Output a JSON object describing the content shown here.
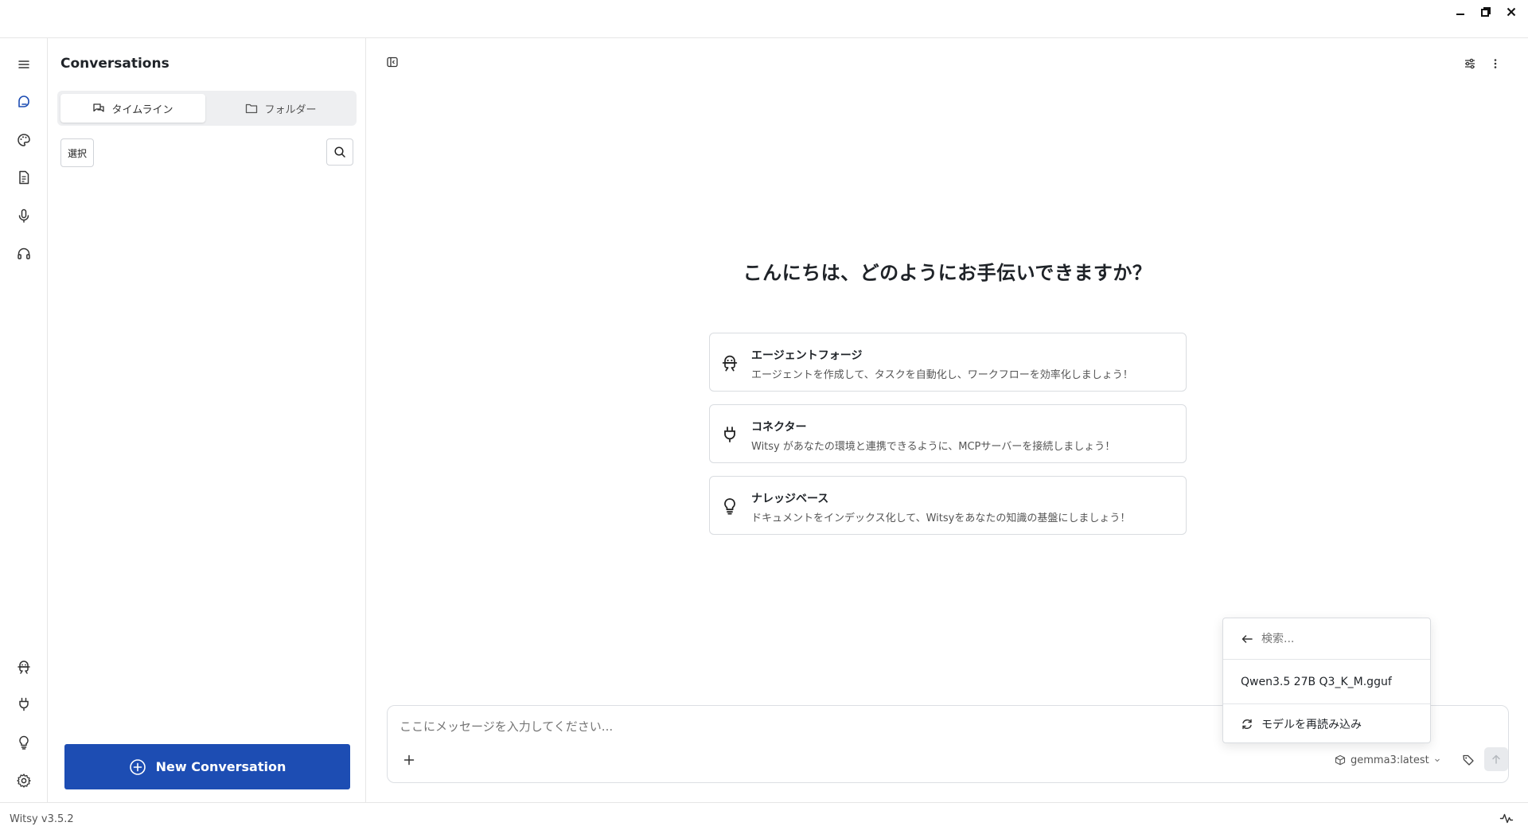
{
  "window": {
    "minimize_icon": "minimize-icon",
    "maximize_icon": "restore-icon",
    "close_icon": "close-icon"
  },
  "rail": {
    "items": [
      {
        "name": "menu",
        "icon": "hamburger-icon"
      },
      {
        "name": "chat",
        "icon": "chat-bubble-icon",
        "active": true
      },
      {
        "name": "design-studio",
        "icon": "palette-icon"
      },
      {
        "name": "scratchpad",
        "icon": "document-icon"
      },
      {
        "name": "dictation",
        "icon": "microphone-icon"
      },
      {
        "name": "voice-mode",
        "icon": "headset-icon"
      },
      {
        "name": "agents",
        "icon": "robot-icon"
      },
      {
        "name": "mcp",
        "icon": "plug-icon"
      },
      {
        "name": "docrepo",
        "icon": "lightbulb-icon"
      },
      {
        "name": "settings",
        "icon": "gear-icon"
      }
    ],
    "accent": "#1d4db3"
  },
  "sidebar": {
    "title": "Conversations",
    "tabs": [
      {
        "label": "タイムライン",
        "active": true
      },
      {
        "label": "フォルダー",
        "active": false
      }
    ],
    "select_label": "選択",
    "new_conversation_label": "New Conversation"
  },
  "main": {
    "welcome": "こんにちは、どのようにお手伝いできますか？",
    "cards": [
      {
        "title": "エージェントフォージ",
        "desc": "エージェントを作成して、タスクを自動化し、ワークフローを効率化しましょう！",
        "icon": "robot-icon"
      },
      {
        "title": "コネクター",
        "desc": "Witsy があなたの環境と連携できるように、MCPサーバーを接続しましょう！",
        "icon": "plug-icon"
      },
      {
        "title": "ナレッジベース",
        "desc": "ドキュメントをインデックス化して、Witsyをあなたの知識の基盤にしましょう！",
        "icon": "lightbulb-icon"
      }
    ],
    "composer": {
      "placeholder": "ここにメッセージを入力してください...",
      "model": "gemma3:latest"
    }
  },
  "model_popup": {
    "search_placeholder": "検索...",
    "model_item": "Qwen3.5 27B Q3_K_M.gguf",
    "reload_label": "モデルを再読み込み"
  },
  "status": {
    "version": "Witsy v3.5.2"
  }
}
